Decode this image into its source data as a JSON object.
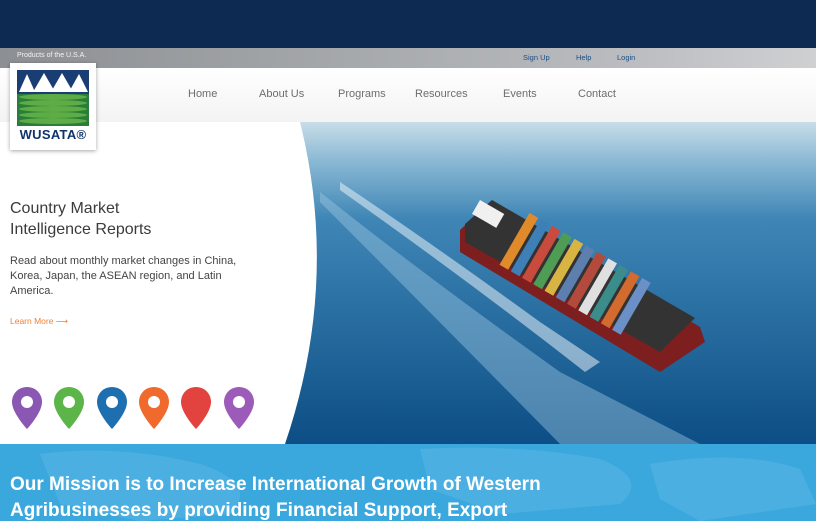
{
  "header": {
    "tagline": "Products of the U.S.A.",
    "utility_links": [
      "Sign Up",
      "Help",
      "Login"
    ],
    "logo_text": "WUSATA®"
  },
  "nav": {
    "items": [
      "Home",
      "About Us",
      "Programs",
      "Resources",
      "Events",
      "Contact"
    ]
  },
  "hero": {
    "headline_line1": "Country Market",
    "headline_line2": "Intelligence Reports",
    "description": "Read about monthly market changes in China, Korea, Japan, the ASEAN region, and Latin America.",
    "learn_more": "Learn More ⟶",
    "pin_colors": [
      "#8a57b2",
      "#5bb548",
      "#1e6fb0",
      "#ef6a2c",
      "#e3433e",
      "#9c5bb8"
    ]
  },
  "mission": {
    "line1": "Our Mission is to Increase International Growth of Western",
    "line2": "Agribusinesses by providing Financial Support, Export"
  },
  "colors": {
    "navy": "#0d2b52",
    "mission_blue": "#3ba8dd",
    "accent_orange": "#e8833a"
  }
}
